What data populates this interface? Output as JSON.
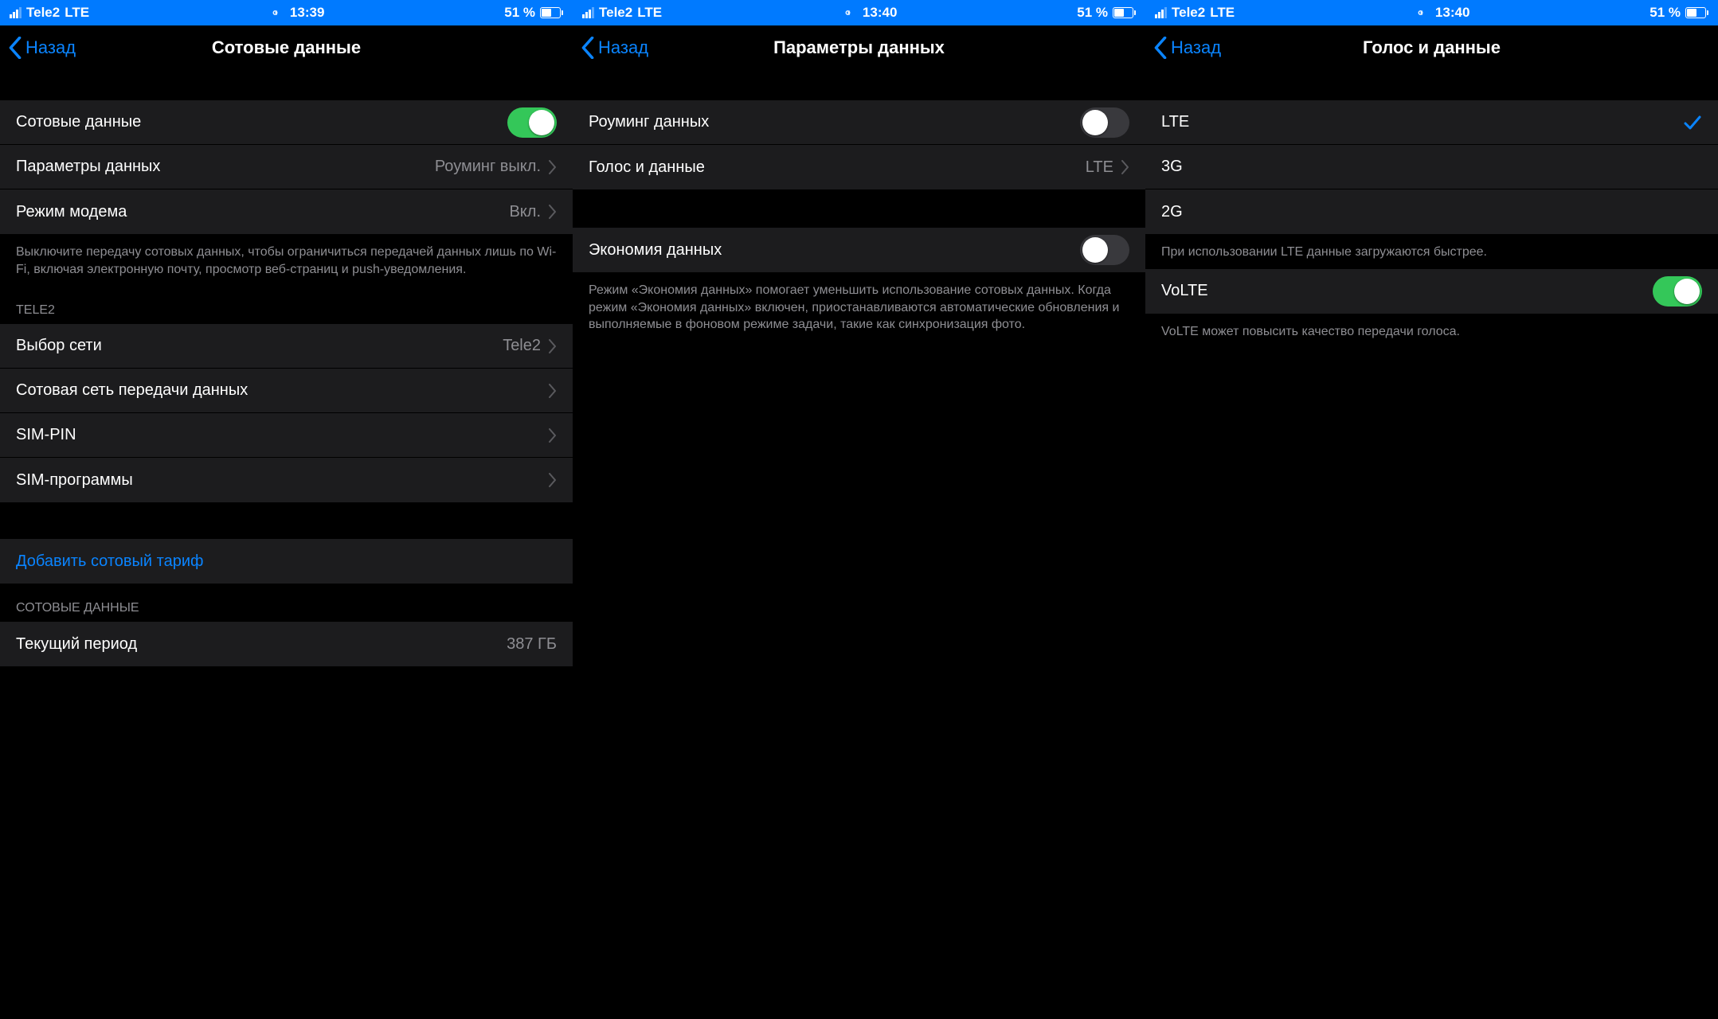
{
  "pane1": {
    "status": {
      "carrier": "Tele2",
      "net": "LTE",
      "time": "13:39",
      "battery": "51 %"
    },
    "back": "Назад",
    "title": "Сотовые данные",
    "rows": {
      "cellular_data": "Сотовые данные",
      "data_params": "Параметры данных",
      "data_params_value": "Роуминг выкл.",
      "hotspot": "Режим модема",
      "hotspot_value": "Вкл."
    },
    "footer1": "Выключите передачу сотовых данных, чтобы ограничиться передачей данных лишь по Wi-Fi, включая электронную почту, просмотр веб-страниц и push-уведомления.",
    "section_tele2": "TELE2",
    "rows2": {
      "network_select": "Выбор сети",
      "network_select_value": "Tele2",
      "cellular_network": "Сотовая сеть передачи данных",
      "sim_pin": "SIM-PIN",
      "sim_apps": "SIM-программы"
    },
    "add_plan": "Добавить сотовый тариф",
    "section_data": "СОТОВЫЕ ДАННЫЕ",
    "current_period": "Текущий период",
    "current_period_value": "387 ГБ"
  },
  "pane2": {
    "status": {
      "carrier": "Tele2",
      "net": "LTE",
      "time": "13:40",
      "battery": "51 %"
    },
    "back": "Назад",
    "title": "Параметры данных",
    "rows": {
      "roaming": "Роуминг данных",
      "voice_data": "Голос и данные",
      "voice_data_value": "LTE",
      "low_data": "Экономия данных"
    },
    "footer": "Режим «Экономия данных» помогает уменьшить использование сотовых данных. Когда режим «Экономия данных» включен, приостанавливаются автоматические обновления и выполняемые в фоновом режиме задачи, такие как синхронизация фото."
  },
  "pane3": {
    "status": {
      "carrier": "Tele2",
      "net": "LTE",
      "time": "13:40",
      "battery": "51 %"
    },
    "back": "Назад",
    "title": "Голос и данные",
    "options": {
      "lte": "LTE",
      "g3": "3G",
      "g2": "2G"
    },
    "footer1": "При использовании LTE данные загружаются быстрее.",
    "volte": "VoLTE",
    "footer2": "VoLTE может повысить качество передачи голоса."
  }
}
